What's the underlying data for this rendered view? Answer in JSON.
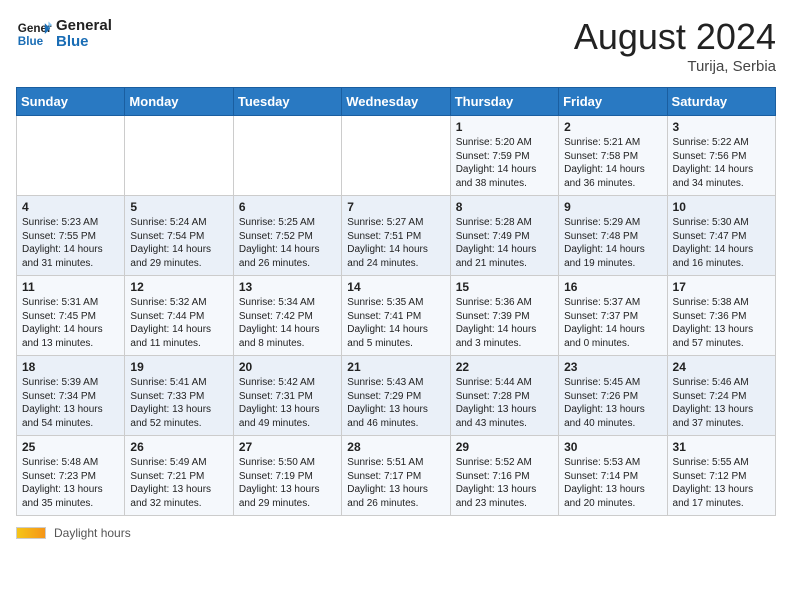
{
  "header": {
    "logo_text_general": "General",
    "logo_text_blue": "Blue",
    "month_year": "August 2024",
    "location": "Turija, Serbia"
  },
  "days_of_week": [
    "Sunday",
    "Monday",
    "Tuesday",
    "Wednesday",
    "Thursday",
    "Friday",
    "Saturday"
  ],
  "footer": {
    "daylight_label": "Daylight hours"
  },
  "weeks": [
    {
      "days": [
        {
          "num": "",
          "info": ""
        },
        {
          "num": "",
          "info": ""
        },
        {
          "num": "",
          "info": ""
        },
        {
          "num": "",
          "info": ""
        },
        {
          "num": "1",
          "info": "Sunrise: 5:20 AM\nSunset: 7:59 PM\nDaylight: 14 hours\nand 38 minutes."
        },
        {
          "num": "2",
          "info": "Sunrise: 5:21 AM\nSunset: 7:58 PM\nDaylight: 14 hours\nand 36 minutes."
        },
        {
          "num": "3",
          "info": "Sunrise: 5:22 AM\nSunset: 7:56 PM\nDaylight: 14 hours\nand 34 minutes."
        }
      ]
    },
    {
      "days": [
        {
          "num": "4",
          "info": "Sunrise: 5:23 AM\nSunset: 7:55 PM\nDaylight: 14 hours\nand 31 minutes."
        },
        {
          "num": "5",
          "info": "Sunrise: 5:24 AM\nSunset: 7:54 PM\nDaylight: 14 hours\nand 29 minutes."
        },
        {
          "num": "6",
          "info": "Sunrise: 5:25 AM\nSunset: 7:52 PM\nDaylight: 14 hours\nand 26 minutes."
        },
        {
          "num": "7",
          "info": "Sunrise: 5:27 AM\nSunset: 7:51 PM\nDaylight: 14 hours\nand 24 minutes."
        },
        {
          "num": "8",
          "info": "Sunrise: 5:28 AM\nSunset: 7:49 PM\nDaylight: 14 hours\nand 21 minutes."
        },
        {
          "num": "9",
          "info": "Sunrise: 5:29 AM\nSunset: 7:48 PM\nDaylight: 14 hours\nand 19 minutes."
        },
        {
          "num": "10",
          "info": "Sunrise: 5:30 AM\nSunset: 7:47 PM\nDaylight: 14 hours\nand 16 minutes."
        }
      ]
    },
    {
      "days": [
        {
          "num": "11",
          "info": "Sunrise: 5:31 AM\nSunset: 7:45 PM\nDaylight: 14 hours\nand 13 minutes."
        },
        {
          "num": "12",
          "info": "Sunrise: 5:32 AM\nSunset: 7:44 PM\nDaylight: 14 hours\nand 11 minutes."
        },
        {
          "num": "13",
          "info": "Sunrise: 5:34 AM\nSunset: 7:42 PM\nDaylight: 14 hours\nand 8 minutes."
        },
        {
          "num": "14",
          "info": "Sunrise: 5:35 AM\nSunset: 7:41 PM\nDaylight: 14 hours\nand 5 minutes."
        },
        {
          "num": "15",
          "info": "Sunrise: 5:36 AM\nSunset: 7:39 PM\nDaylight: 14 hours\nand 3 minutes."
        },
        {
          "num": "16",
          "info": "Sunrise: 5:37 AM\nSunset: 7:37 PM\nDaylight: 14 hours\nand 0 minutes."
        },
        {
          "num": "17",
          "info": "Sunrise: 5:38 AM\nSunset: 7:36 PM\nDaylight: 13 hours\nand 57 minutes."
        }
      ]
    },
    {
      "days": [
        {
          "num": "18",
          "info": "Sunrise: 5:39 AM\nSunset: 7:34 PM\nDaylight: 13 hours\nand 54 minutes."
        },
        {
          "num": "19",
          "info": "Sunrise: 5:41 AM\nSunset: 7:33 PM\nDaylight: 13 hours\nand 52 minutes."
        },
        {
          "num": "20",
          "info": "Sunrise: 5:42 AM\nSunset: 7:31 PM\nDaylight: 13 hours\nand 49 minutes."
        },
        {
          "num": "21",
          "info": "Sunrise: 5:43 AM\nSunset: 7:29 PM\nDaylight: 13 hours\nand 46 minutes."
        },
        {
          "num": "22",
          "info": "Sunrise: 5:44 AM\nSunset: 7:28 PM\nDaylight: 13 hours\nand 43 minutes."
        },
        {
          "num": "23",
          "info": "Sunrise: 5:45 AM\nSunset: 7:26 PM\nDaylight: 13 hours\nand 40 minutes."
        },
        {
          "num": "24",
          "info": "Sunrise: 5:46 AM\nSunset: 7:24 PM\nDaylight: 13 hours\nand 37 minutes."
        }
      ]
    },
    {
      "days": [
        {
          "num": "25",
          "info": "Sunrise: 5:48 AM\nSunset: 7:23 PM\nDaylight: 13 hours\nand 35 minutes."
        },
        {
          "num": "26",
          "info": "Sunrise: 5:49 AM\nSunset: 7:21 PM\nDaylight: 13 hours\nand 32 minutes."
        },
        {
          "num": "27",
          "info": "Sunrise: 5:50 AM\nSunset: 7:19 PM\nDaylight: 13 hours\nand 29 minutes."
        },
        {
          "num": "28",
          "info": "Sunrise: 5:51 AM\nSunset: 7:17 PM\nDaylight: 13 hours\nand 26 minutes."
        },
        {
          "num": "29",
          "info": "Sunrise: 5:52 AM\nSunset: 7:16 PM\nDaylight: 13 hours\nand 23 minutes."
        },
        {
          "num": "30",
          "info": "Sunrise: 5:53 AM\nSunset: 7:14 PM\nDaylight: 13 hours\nand 20 minutes."
        },
        {
          "num": "31",
          "info": "Sunrise: 5:55 AM\nSunset: 7:12 PM\nDaylight: 13 hours\nand 17 minutes."
        }
      ]
    }
  ]
}
